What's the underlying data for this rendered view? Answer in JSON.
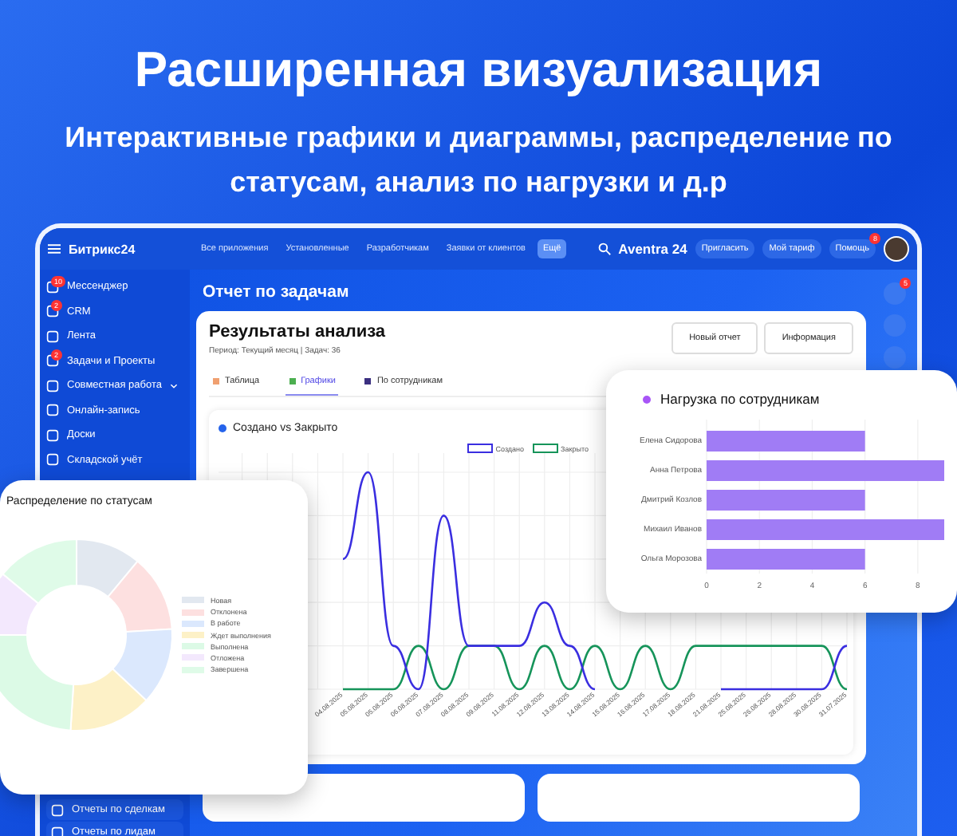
{
  "headline": "Расширенная визуализация",
  "subtitle": "Интерактивные графики и диаграммы, распределение по статусам, анализ по нагрузки и д.р",
  "app": {
    "logo": "Битрикс24",
    "top_nav": [
      {
        "label": "Все приложения",
        "selected": false
      },
      {
        "label": "Установленные",
        "selected": false
      },
      {
        "label": "Разработчикам",
        "selected": false
      },
      {
        "label": "Заявки от клиентов",
        "selected": false
      },
      {
        "label": "Ещё",
        "selected": true
      }
    ],
    "portal": "Aventra 24",
    "header_buttons": [
      {
        "label": "Пригласить"
      },
      {
        "label": "Мой тариф"
      },
      {
        "label": "Помощь",
        "badge": "8"
      }
    ],
    "sidebar": [
      {
        "label": "Мессенджер",
        "badge": "10",
        "expandable": false
      },
      {
        "label": "CRM",
        "badge": "2",
        "expandable": false
      },
      {
        "label": "Лента",
        "expandable": false
      },
      {
        "label": "Задачи и Проекты",
        "badge": "2",
        "expandable": false
      },
      {
        "label": "Совместная работа",
        "expandable": true
      },
      {
        "label": "Онлайн-запись",
        "expandable": false
      },
      {
        "label": "Доски",
        "expandable": false
      },
      {
        "label": "Складской учёт",
        "expandable": false
      }
    ],
    "sidebar_bottom": [
      {
        "label": "Отчеты по сделкам"
      },
      {
        "label": "Отчеты по лидам"
      }
    ],
    "rail_badge": "5",
    "page_title": "Отчет по задачам",
    "panel": {
      "title": "Результаты анализа",
      "meta": "Период: Текущий месяц | Задач: 36",
      "buttons": [
        "Новый отчет",
        "Информация"
      ],
      "tabs": [
        {
          "label": "Таблица",
          "selected": false
        },
        {
          "label": "Графики",
          "selected": true
        },
        {
          "label": "По сотрудникам",
          "selected": false
        }
      ],
      "line_card": {
        "title": "Создано vs Закрыто",
        "legend": [
          {
            "label": "Создано",
            "color": "#3a2ee0"
          },
          {
            "label": "Закрыто",
            "color": "#16945a"
          }
        ],
        "x_labels": [
          "04.08.2025",
          "05.08.2025",
          "05.08.2025",
          "06.08.2025",
          "07.08.2025",
          "08.08.2025",
          "09.08.2025",
          "11.08.2025",
          "12.08.2025",
          "13.08.2025",
          "14.08.2025",
          "15.08.2025",
          "16.08.2025",
          "17.08.2025",
          "18.08.2025",
          "21.08.2025",
          "25.08.2025",
          "26.08.2025",
          "28.08.2025",
          "30.08.2025",
          "31.07.2025"
        ]
      }
    }
  },
  "workload_card": {
    "title": "Нагрузка по сотрудникам",
    "chart_data": {
      "type": "bar",
      "orientation": "horizontal",
      "grid": true,
      "categories": [
        "Елена Сидорова",
        "Анна Петрова",
        "Дмитрий Козлов",
        "Михаил Иванов",
        "Ольга Морозова"
      ],
      "values": [
        6,
        9,
        6,
        9,
        6
      ],
      "xlim": [
        0,
        9
      ],
      "xticks": [
        0,
        2,
        4,
        6,
        8
      ]
    }
  },
  "status_card": {
    "title": "Распределение по статусам",
    "legend": [
      {
        "label": "Новая",
        "color": "#e2e8f0"
      },
      {
        "label": "Отклонена",
        "color": "#fde0e0"
      },
      {
        "label": "В работе",
        "color": "#dbe8fd"
      },
      {
        "label": "Ждет выполнения",
        "color": "#fdf1c7"
      },
      {
        "label": "Выполнена",
        "color": "#dcfae6"
      },
      {
        "label": "Отложена",
        "color": "#f3e8fd"
      },
      {
        "label": "Завершена",
        "color": "#dffbe8"
      }
    ]
  }
}
